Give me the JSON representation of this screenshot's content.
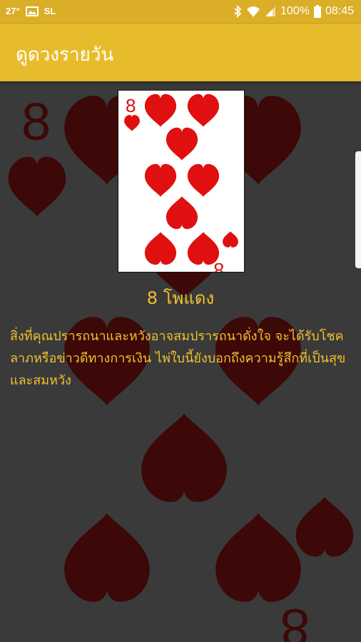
{
  "status_bar": {
    "temperature": "27°",
    "carrier": "SL",
    "battery": "100%",
    "time": "08:45",
    "icons": [
      "image-icon",
      "bluetooth-icon",
      "wifi-icon",
      "signal-icon",
      "battery-icon"
    ]
  },
  "app_bar": {
    "title": "ดูดวงรายวัน"
  },
  "card": {
    "rank": "8",
    "suit": "heart",
    "name": "8 โพแดง",
    "meaning": "สิ่งที่คุณปรารถนาและหวังอาจสมปรารถนาดั่งใจ จะได้รับโชคลาภหรือข่าวดีทางการเงิน ไพ่ใบนี้ยังบอกถึงความรู้สึกที่เป็นสุขและสมหวัง"
  },
  "colors": {
    "accent": "#e7bc2c",
    "status_bar": "#dbae28",
    "text_gold": "#f2c12e",
    "background": "#3a3a3a",
    "card_red": "#e01010",
    "bg_suit": "#3c0808"
  }
}
